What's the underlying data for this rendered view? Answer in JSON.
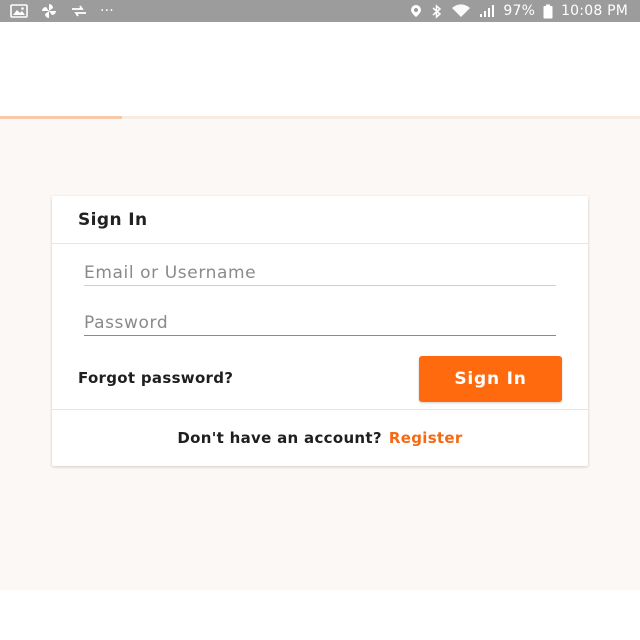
{
  "status_bar": {
    "icons_left": [
      "image-icon",
      "pinwheel-icon",
      "sync-arrows-icon",
      "more-dots-icon"
    ],
    "icons_right": [
      "location-icon",
      "bluetooth-icon",
      "wifi-icon",
      "signal-icon",
      "battery-icon"
    ],
    "more_dots": "···",
    "battery": "97%",
    "time": "10:08 PM"
  },
  "progress": {
    "value": 0.19
  },
  "signin": {
    "title": "Sign In",
    "email_placeholder": "Email or Username",
    "password_placeholder": "Password",
    "forgot_label": "Forgot password?",
    "submit_label": "Sign In",
    "footer_prompt": "Don't have an account?",
    "register_label": "Register"
  },
  "colors": {
    "accent": "#ff6a0f",
    "link": "#f46a14",
    "status_bar": "#9c9c9c",
    "background": "#fcf8f6"
  }
}
